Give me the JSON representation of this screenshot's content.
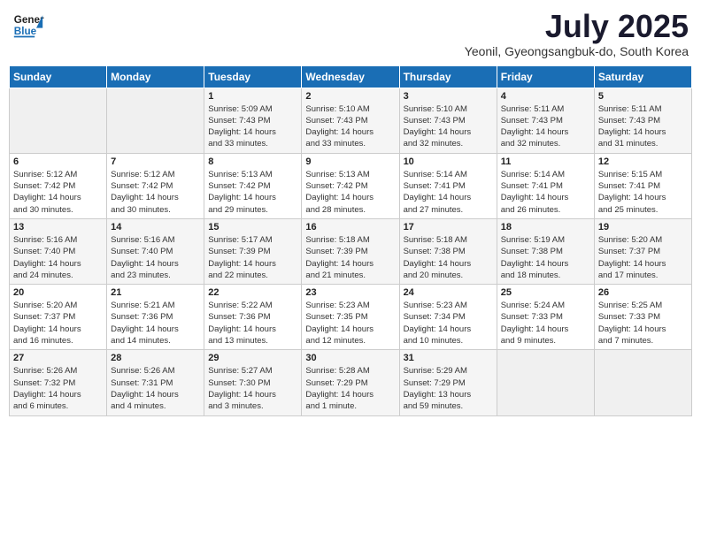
{
  "header": {
    "logo_general": "General",
    "logo_blue": "Blue",
    "month_year": "July 2025",
    "subtitle": "Yeonil, Gyeongsangbuk-do, South Korea"
  },
  "weekdays": [
    "Sunday",
    "Monday",
    "Tuesday",
    "Wednesday",
    "Thursday",
    "Friday",
    "Saturday"
  ],
  "weeks": [
    [
      {
        "day": "",
        "content": ""
      },
      {
        "day": "",
        "content": ""
      },
      {
        "day": "1",
        "content": "Sunrise: 5:09 AM\nSunset: 7:43 PM\nDaylight: 14 hours\nand 33 minutes."
      },
      {
        "day": "2",
        "content": "Sunrise: 5:10 AM\nSunset: 7:43 PM\nDaylight: 14 hours\nand 33 minutes."
      },
      {
        "day": "3",
        "content": "Sunrise: 5:10 AM\nSunset: 7:43 PM\nDaylight: 14 hours\nand 32 minutes."
      },
      {
        "day": "4",
        "content": "Sunrise: 5:11 AM\nSunset: 7:43 PM\nDaylight: 14 hours\nand 32 minutes."
      },
      {
        "day": "5",
        "content": "Sunrise: 5:11 AM\nSunset: 7:43 PM\nDaylight: 14 hours\nand 31 minutes."
      }
    ],
    [
      {
        "day": "6",
        "content": "Sunrise: 5:12 AM\nSunset: 7:42 PM\nDaylight: 14 hours\nand 30 minutes."
      },
      {
        "day": "7",
        "content": "Sunrise: 5:12 AM\nSunset: 7:42 PM\nDaylight: 14 hours\nand 30 minutes."
      },
      {
        "day": "8",
        "content": "Sunrise: 5:13 AM\nSunset: 7:42 PM\nDaylight: 14 hours\nand 29 minutes."
      },
      {
        "day": "9",
        "content": "Sunrise: 5:13 AM\nSunset: 7:42 PM\nDaylight: 14 hours\nand 28 minutes."
      },
      {
        "day": "10",
        "content": "Sunrise: 5:14 AM\nSunset: 7:41 PM\nDaylight: 14 hours\nand 27 minutes."
      },
      {
        "day": "11",
        "content": "Sunrise: 5:14 AM\nSunset: 7:41 PM\nDaylight: 14 hours\nand 26 minutes."
      },
      {
        "day": "12",
        "content": "Sunrise: 5:15 AM\nSunset: 7:41 PM\nDaylight: 14 hours\nand 25 minutes."
      }
    ],
    [
      {
        "day": "13",
        "content": "Sunrise: 5:16 AM\nSunset: 7:40 PM\nDaylight: 14 hours\nand 24 minutes."
      },
      {
        "day": "14",
        "content": "Sunrise: 5:16 AM\nSunset: 7:40 PM\nDaylight: 14 hours\nand 23 minutes."
      },
      {
        "day": "15",
        "content": "Sunrise: 5:17 AM\nSunset: 7:39 PM\nDaylight: 14 hours\nand 22 minutes."
      },
      {
        "day": "16",
        "content": "Sunrise: 5:18 AM\nSunset: 7:39 PM\nDaylight: 14 hours\nand 21 minutes."
      },
      {
        "day": "17",
        "content": "Sunrise: 5:18 AM\nSunset: 7:38 PM\nDaylight: 14 hours\nand 20 minutes."
      },
      {
        "day": "18",
        "content": "Sunrise: 5:19 AM\nSunset: 7:38 PM\nDaylight: 14 hours\nand 18 minutes."
      },
      {
        "day": "19",
        "content": "Sunrise: 5:20 AM\nSunset: 7:37 PM\nDaylight: 14 hours\nand 17 minutes."
      }
    ],
    [
      {
        "day": "20",
        "content": "Sunrise: 5:20 AM\nSunset: 7:37 PM\nDaylight: 14 hours\nand 16 minutes."
      },
      {
        "day": "21",
        "content": "Sunrise: 5:21 AM\nSunset: 7:36 PM\nDaylight: 14 hours\nand 14 minutes."
      },
      {
        "day": "22",
        "content": "Sunrise: 5:22 AM\nSunset: 7:36 PM\nDaylight: 14 hours\nand 13 minutes."
      },
      {
        "day": "23",
        "content": "Sunrise: 5:23 AM\nSunset: 7:35 PM\nDaylight: 14 hours\nand 12 minutes."
      },
      {
        "day": "24",
        "content": "Sunrise: 5:23 AM\nSunset: 7:34 PM\nDaylight: 14 hours\nand 10 minutes."
      },
      {
        "day": "25",
        "content": "Sunrise: 5:24 AM\nSunset: 7:33 PM\nDaylight: 14 hours\nand 9 minutes."
      },
      {
        "day": "26",
        "content": "Sunrise: 5:25 AM\nSunset: 7:33 PM\nDaylight: 14 hours\nand 7 minutes."
      }
    ],
    [
      {
        "day": "27",
        "content": "Sunrise: 5:26 AM\nSunset: 7:32 PM\nDaylight: 14 hours\nand 6 minutes."
      },
      {
        "day": "28",
        "content": "Sunrise: 5:26 AM\nSunset: 7:31 PM\nDaylight: 14 hours\nand 4 minutes."
      },
      {
        "day": "29",
        "content": "Sunrise: 5:27 AM\nSunset: 7:30 PM\nDaylight: 14 hours\nand 3 minutes."
      },
      {
        "day": "30",
        "content": "Sunrise: 5:28 AM\nSunset: 7:29 PM\nDaylight: 14 hours\nand 1 minute."
      },
      {
        "day": "31",
        "content": "Sunrise: 5:29 AM\nSunset: 7:29 PM\nDaylight: 13 hours\nand 59 minutes."
      },
      {
        "day": "",
        "content": ""
      },
      {
        "day": "",
        "content": ""
      }
    ]
  ]
}
